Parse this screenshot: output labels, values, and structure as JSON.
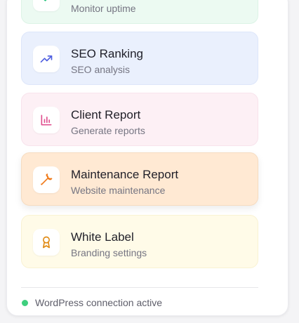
{
  "cards": [
    {
      "title": "",
      "subtitle": "Monitor uptime",
      "icon": "check-icon",
      "color": "#22c27a"
    },
    {
      "title": "SEO Ranking",
      "subtitle": "SEO analysis",
      "icon": "trending-up-icon",
      "color": "#4f5fe0"
    },
    {
      "title": "Client Report",
      "subtitle": "Generate reports",
      "icon": "bar-chart-icon",
      "color": "#e0508f"
    },
    {
      "title": "Maintenance Report",
      "subtitle": "Website maintenance",
      "icon": "wrench-icon",
      "color": "#f07a1a"
    },
    {
      "title": "White Label",
      "subtitle": "Branding settings",
      "icon": "award-icon",
      "color": "#e08a14"
    }
  ],
  "status": {
    "text": "WordPress connection active",
    "color": "#3fcf7e"
  }
}
